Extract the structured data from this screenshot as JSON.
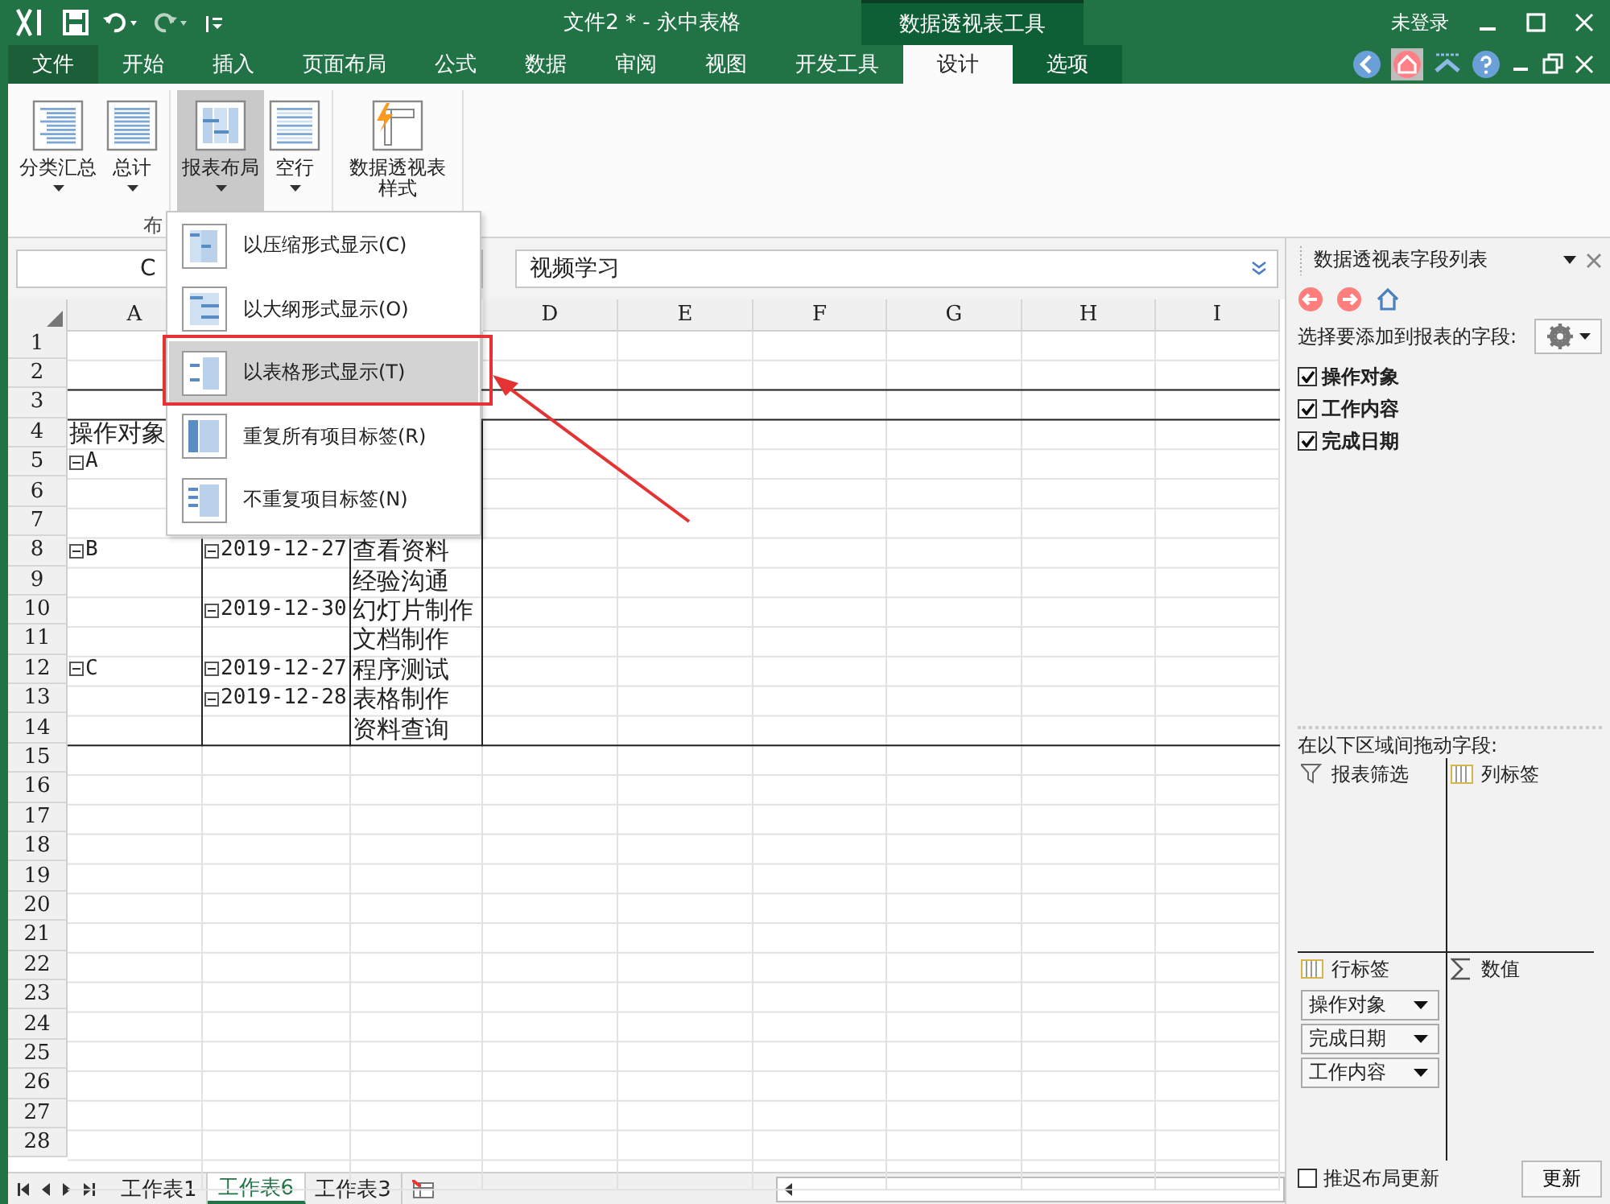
{
  "window": {
    "title": "文件2 * - 永中表格",
    "context_group": "数据透视表工具",
    "user": "未登录"
  },
  "ribbon_tabs": [
    {
      "label": "文件",
      "kind": "file",
      "selected": false
    },
    {
      "label": "开始",
      "kind": "tab",
      "selected": false
    },
    {
      "label": "插入",
      "kind": "tab",
      "selected": false
    },
    {
      "label": "页面布局",
      "kind": "tab",
      "selected": false
    },
    {
      "label": "公式",
      "kind": "tab",
      "selected": false
    },
    {
      "label": "数据",
      "kind": "tab",
      "selected": false
    },
    {
      "label": "审阅",
      "kind": "tab",
      "selected": false
    },
    {
      "label": "视图",
      "kind": "tab",
      "selected": false
    },
    {
      "label": "开发工具",
      "kind": "tab",
      "selected": false
    },
    {
      "label": "设计",
      "kind": "context",
      "selected": true
    },
    {
      "label": "选项",
      "kind": "context",
      "selected": false
    }
  ],
  "ribbon": {
    "buttons": [
      {
        "label": "分类汇总",
        "selected": false
      },
      {
        "label": "总计",
        "selected": false
      },
      {
        "label": "报表布局",
        "selected": true
      },
      {
        "label": "空行",
        "selected": false
      },
      {
        "label": "数据透视表样式",
        "selected": false
      }
    ],
    "group_label": "布"
  },
  "formula_bar": {
    "name_box": "C",
    "value": "视频学习"
  },
  "layout_menu": [
    {
      "label": "以压缩形式显示(C)",
      "selected": false
    },
    {
      "label": "以大纲形式显示(O)",
      "selected": false
    },
    {
      "label": "以表格形式显示(T)",
      "selected": true
    },
    {
      "label": "重复所有项目标签(R)",
      "selected": false
    },
    {
      "label": "不重复项目标签(N)",
      "selected": false
    }
  ],
  "sheet": {
    "column_headers": [
      "A",
      "D",
      "E",
      "F",
      "G",
      "H",
      "I"
    ],
    "rows": [
      {
        "number": "1"
      },
      {
        "number": "2"
      },
      {
        "number": "3"
      },
      {
        "number": "4",
        "column_1": {
          "text": "操作对象"
        }
      },
      {
        "number": "5",
        "column_1": {
          "text": "A",
          "collapsible": true
        }
      },
      {
        "number": "6"
      },
      {
        "number": "7"
      },
      {
        "number": "8",
        "column_1": {
          "text": "B",
          "collapsible": true
        },
        "column_2": {
          "text": "2019-12-27",
          "collapsible": true
        },
        "column_3": {
          "text": "查看资料"
        }
      },
      {
        "number": "9",
        "column_3": {
          "text": "经验沟通"
        }
      },
      {
        "number": "10",
        "column_2": {
          "text": "2019-12-30",
          "collapsible": true
        },
        "column_3": {
          "text": "幻灯片制作"
        }
      },
      {
        "number": "11",
        "column_3": {
          "text": "文档制作"
        }
      },
      {
        "number": "12",
        "column_1": {
          "text": "C",
          "collapsible": true
        },
        "column_2": {
          "text": "2019-12-27",
          "collapsible": true
        },
        "column_3": {
          "text": "程序测试"
        }
      },
      {
        "number": "13",
        "column_2": {
          "text": "2019-12-28",
          "collapsible": true
        },
        "column_3": {
          "text": "表格制作"
        }
      },
      {
        "number": "14",
        "column_3": {
          "text": "资料查询"
        }
      },
      {
        "number": "15"
      },
      {
        "number": "16"
      },
      {
        "number": "17"
      },
      {
        "number": "18"
      },
      {
        "number": "19"
      },
      {
        "number": "20"
      },
      {
        "number": "21"
      },
      {
        "number": "22"
      },
      {
        "number": "23"
      },
      {
        "number": "24"
      },
      {
        "number": "25"
      },
      {
        "number": "26"
      },
      {
        "number": "27"
      },
      {
        "number": "28"
      }
    ]
  },
  "sheet_tabs": [
    {
      "label": "工作表1",
      "selected": false
    },
    {
      "label": "工作表6",
      "selected": true
    },
    {
      "label": "工作表3",
      "selected": false
    }
  ],
  "field_panel": {
    "title": "数据透视表字段列表",
    "prompt": "选择要添加到报表的字段:",
    "fields": [
      {
        "label": "操作对象",
        "checked": true
      },
      {
        "label": "工作内容",
        "checked": true
      },
      {
        "label": "完成日期",
        "checked": true
      }
    ],
    "areas_prompt": "在以下区域间拖动字段:",
    "areas": [
      {
        "label": "报表筛选",
        "kind": "filter"
      },
      {
        "label": "列标签",
        "kind": "columns"
      },
      {
        "label": "行标签",
        "kind": "rows",
        "items": [
          "操作对象",
          "完成日期",
          "工作内容"
        ]
      },
      {
        "label": "数值",
        "kind": "values"
      }
    ],
    "defer_update": {
      "label": "推迟布局更新",
      "checked": false
    },
    "update_button": "更新"
  }
}
